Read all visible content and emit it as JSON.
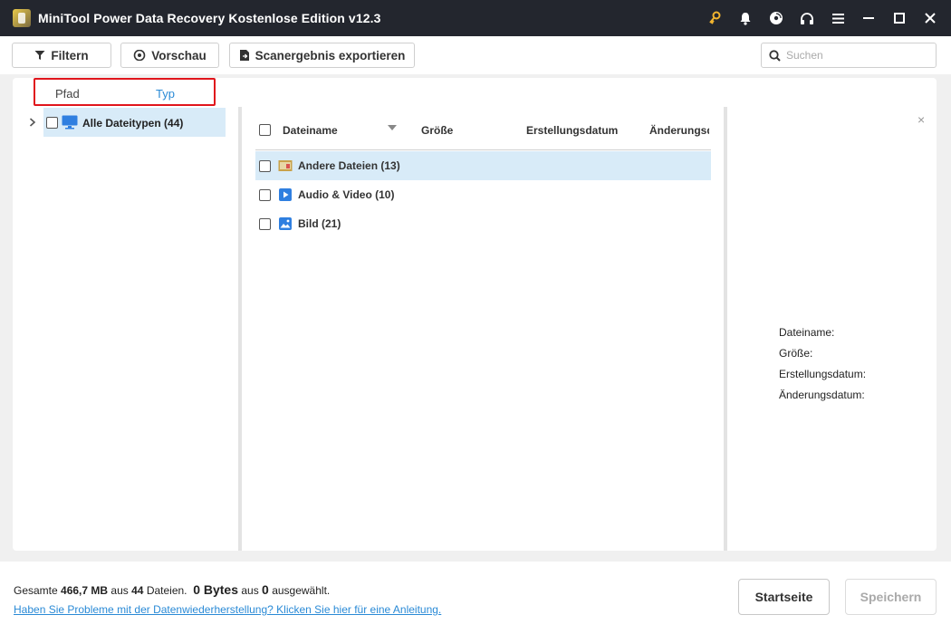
{
  "window": {
    "title": "MiniTool Power Data Recovery Kostenlose Edition v12.3",
    "icons": [
      "key-icon",
      "bell-icon",
      "disc-icon",
      "headphones-icon",
      "menu-icon",
      "minimize-icon",
      "maximize-icon",
      "close-icon"
    ]
  },
  "toolbar": {
    "filter_label": "Filtern",
    "preview_label": "Vorschau",
    "export_label": "Scanergebnis exportieren",
    "search_placeholder": "Suchen"
  },
  "tabs": {
    "path_label": "Pfad",
    "type_label": "Typ",
    "active": "Typ"
  },
  "tree": {
    "root_label": "Alle Dateitypen (44)"
  },
  "list": {
    "columns": [
      "Dateiname",
      "Größe",
      "Erstellungsdatum",
      "Änderungsd"
    ],
    "rows": [
      {
        "label": "Andere Dateien (13)",
        "icon": "other-files-icon",
        "selected": true
      },
      {
        "label": "Audio & Video (10)",
        "icon": "audio-video-icon",
        "selected": false
      },
      {
        "label": "Bild (21)",
        "icon": "image-icon",
        "selected": false
      }
    ]
  },
  "details": {
    "close_label": "×",
    "filename_label": "Dateiname:",
    "size_label": "Größe:",
    "created_label": "Erstellungsdatum:",
    "modified_label": "Änderungsdatum:"
  },
  "footer": {
    "total_prefix": "Gesamte",
    "total_size": "466,7 MB",
    "of_label": "aus",
    "file_count": "44",
    "files_label": "Dateien.",
    "selected_size": "0 Bytes",
    "selected_count": "0",
    "selected_label": "ausgewählt.",
    "help_link": "Haben Sie Probleme mit der Datenwiederherstellung? Klicken Sie hier für eine Anleitung.",
    "home_button": "Startseite",
    "save_button": "Speichern"
  },
  "colors": {
    "titlebar": "#23262e",
    "accent": "#2a8ad6",
    "highlight_border": "#e0151c",
    "selection": "#d8ebf8"
  }
}
